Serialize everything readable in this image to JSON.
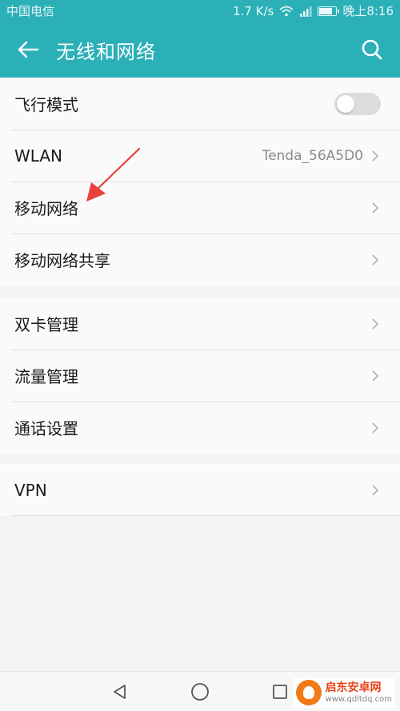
{
  "status_bar": {
    "carrier": "中国电信",
    "speed": "1.7 K/s",
    "time": "晚上8:16",
    "battery_level": 0.85
  },
  "app_bar": {
    "title": "无线和网络",
    "back_icon": "arrow-left-icon",
    "search_icon": "search-icon"
  },
  "groups": [
    {
      "items": [
        {
          "label": "飞行模式",
          "type": "toggle",
          "on": false
        },
        {
          "label": "WLAN",
          "type": "link",
          "value": "Tenda_56A5D0"
        },
        {
          "label": "移动网络",
          "type": "link"
        },
        {
          "label": "移动网络共享",
          "type": "link"
        }
      ]
    },
    {
      "items": [
        {
          "label": "双卡管理",
          "type": "link"
        },
        {
          "label": "流量管理",
          "type": "link"
        },
        {
          "label": "通话设置",
          "type": "link"
        }
      ]
    },
    {
      "items": [
        {
          "label": "VPN",
          "type": "link"
        }
      ]
    }
  ],
  "nav_bar": {
    "back_icon": "triangle-back-icon",
    "home_icon": "circle-home-icon",
    "recents_icon": "square-recents-icon"
  },
  "watermark": {
    "name": "启东安卓网",
    "url": "www.qdltdq.com"
  },
  "colors": {
    "accent": "#2bb0b8",
    "annotation_arrow": "#e8403a"
  }
}
